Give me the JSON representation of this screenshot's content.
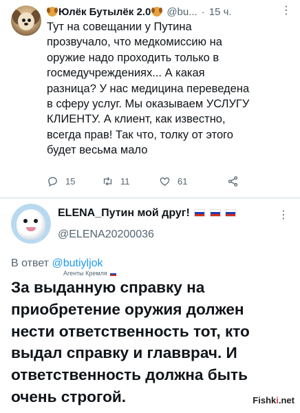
{
  "tweet1": {
    "author_name": "Юлёк Бутылёк 2.0",
    "handle": "@bu...",
    "separator": "·",
    "time": "15 ч.",
    "more": "⋮",
    "text": "Тут на совещании у Путина\nпрозвучало, что медкомиссию на\nоружие надо проходить только в\nгосмедучреждениях... А какая\nразница? У нас медицина переведена\nв сферу услуг. Мы оказываем УСЛУГУ\nКЛИЕНТУ. А клиент, как известно,\nвсегда прав! Так что, толку от этого\nбудет весьма мало",
    "replies": "15",
    "retweets": "11",
    "likes": "61",
    "icons": [
      "dog-emoji-icon",
      "reply-icon",
      "retweet-icon",
      "like-icon",
      "share-icon"
    ]
  },
  "tweet2": {
    "author_name": "ELENA_Путин мой друг!",
    "handle": "@ELENA20200036",
    "more": "⋮",
    "reply_prefix": "В ответ",
    "reply_handle": "@butiyljok",
    "agent_tag": "Агенты Кремля",
    "text": "За выданную справку на\nприобретение оружия должен\nнести ответственность тот, кто\nвыдал справку и главврач. И\nответственность должна быть\nочень строгой.",
    "icons": [
      "russia-flag-icon"
    ]
  },
  "watermark": {
    "pre": "Fishk",
    "accent": "i",
    "post": ".net"
  },
  "colors": {
    "text": "#0f1419",
    "secondary": "#536471",
    "link": "#1d9bf0",
    "divider": "#cfd9de"
  }
}
